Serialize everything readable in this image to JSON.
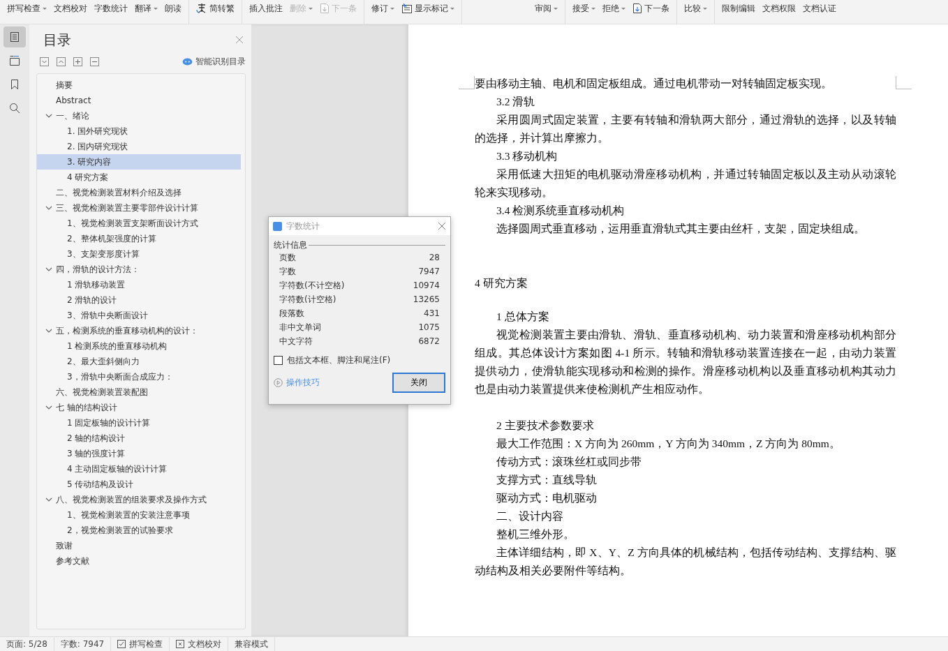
{
  "toolbar": {
    "groups": [
      [
        {
          "kind": "text",
          "label": "拼写检查",
          "caret": true,
          "disabled": false
        },
        {
          "kind": "text",
          "label": "文档校对",
          "caret": false,
          "disabled": false
        },
        {
          "kind": "text",
          "label": "字数统计",
          "caret": false,
          "disabled": false
        },
        {
          "kind": "text",
          "label": "翻译",
          "caret": true,
          "disabled": false
        },
        {
          "kind": "text",
          "label": "朗读",
          "caret": false,
          "disabled": false
        }
      ],
      [
        {
          "kind": "convert",
          "label": "简转繁",
          "caret": false,
          "disabled": false
        }
      ],
      [
        {
          "kind": "text",
          "label": "插入批注",
          "caret": false,
          "disabled": false
        },
        {
          "kind": "text",
          "label": "删除",
          "caret": true,
          "disabled": true
        },
        {
          "kind": "next",
          "label": "下一条",
          "caret": false,
          "disabled": true
        }
      ],
      [
        {
          "kind": "text",
          "label": "修订",
          "caret": true,
          "disabled": false
        },
        {
          "kind": "markup",
          "label": "显示标记",
          "caret": true,
          "disabled": false
        }
      ],
      [
        {
          "kind": "text",
          "label": "审阅",
          "caret": true,
          "disabled": false
        }
      ],
      [
        {
          "kind": "text",
          "label": "接受",
          "caret": true,
          "disabled": false
        },
        {
          "kind": "text",
          "label": "拒绝",
          "caret": true,
          "disabled": false
        },
        {
          "kind": "next",
          "label": "下一条",
          "caret": false,
          "disabled": false
        }
      ],
      [
        {
          "kind": "text",
          "label": "比较",
          "caret": true,
          "disabled": false
        }
      ],
      [
        {
          "kind": "text",
          "label": "限制编辑",
          "caret": false,
          "disabled": false
        },
        {
          "kind": "text",
          "label": "文档权限",
          "caret": false,
          "disabled": false
        },
        {
          "kind": "text",
          "label": "文档认证",
          "caret": false,
          "disabled": false
        }
      ]
    ]
  },
  "rail_tabs": [
    {
      "kind": "toc",
      "selected": true
    },
    {
      "kind": "nav",
      "selected": false
    },
    {
      "kind": "bookmark",
      "selected": false
    },
    {
      "kind": "search",
      "selected": false
    }
  ],
  "toc": {
    "title": "目录",
    "smart_label": "智能识别目录",
    "items": [
      {
        "label": "摘要",
        "selected": false
      },
      {
        "label": "Abstract",
        "selected": false
      },
      {
        "label": "一、绪论",
        "selected": false,
        "expanded": true,
        "children": [
          {
            "label": "1. 国外研究现状",
            "selected": false
          },
          {
            "label": "2. 国内研究现状",
            "selected": false
          },
          {
            "label": "3. 研究内容",
            "selected": true
          },
          {
            "label": "4  研究方案",
            "selected": false
          }
        ]
      },
      {
        "label": "二、视觉检测装置材料介绍及选择",
        "selected": false
      },
      {
        "label": "三、视觉检测装置主要零部件设计计算",
        "selected": false,
        "expanded": true,
        "children": [
          {
            "label": "1、视觉检测装置支架断面设计方式",
            "selected": false
          },
          {
            "label": "2、整体机架强度的计算",
            "selected": false
          },
          {
            "label": "3、支架变形度计算",
            "selected": false
          }
        ]
      },
      {
        "label": "四，滑轨的设计方法：",
        "selected": false,
        "expanded": true,
        "children": [
          {
            "label": "1  滑轨移动装置",
            "selected": false
          },
          {
            "label": "2 滑轨的设计",
            "selected": false
          },
          {
            "label": "3、滑轨中央断面设计",
            "selected": false
          }
        ]
      },
      {
        "label": "五，检测系统的垂直移动机构的设计：",
        "selected": false,
        "expanded": true,
        "children": [
          {
            "label": "1  检测系统的垂直移动机构",
            "selected": false
          },
          {
            "label": "2、最大歪斜侧向力",
            "selected": false
          },
          {
            "label": "3，滑轨中央断面合成应力：",
            "selected": false
          }
        ]
      },
      {
        "label": "六、视觉检测装置装配图",
        "selected": false
      },
      {
        "label": "七  轴的结构设计",
        "selected": false,
        "expanded": true,
        "children": [
          {
            "label": "1    固定板轴的设计计算",
            "selected": false
          },
          {
            "label": "2 轴的结构设计",
            "selected": false
          },
          {
            "label": "3    轴的强度计算",
            "selected": false
          },
          {
            "label": "4  主动固定板轴的设计计算",
            "selected": false
          },
          {
            "label": "5  传动结构及设计",
            "selected": false
          }
        ]
      },
      {
        "label": "八、视觉检测装置的组装要求及操作方式",
        "selected": false,
        "expanded": true,
        "children": [
          {
            "label": "1、视觉检测装置的安装注意事项",
            "selected": false
          },
          {
            "label": "2，视觉检测装置的试验要求",
            "selected": false
          }
        ]
      },
      {
        "label": "致谢",
        "selected": false
      },
      {
        "label": "参考文献",
        "selected": false
      }
    ]
  },
  "document": {
    "paragraphs": [
      {
        "kind": "text",
        "text": "要由移动主轴、电机和固定板组成。通过电机带动一对转轴固定板实现。"
      },
      {
        "kind": "indent",
        "text": "3.2  滑轨"
      },
      {
        "kind": "indent",
        "text": "采用圆周式固定装置，主要有转轴和滑轨两大部分，通过滑轨的选择，以及转轴的选择，并计算出摩擦力。"
      },
      {
        "kind": "indent",
        "text": "3.3  移动机构"
      },
      {
        "kind": "indent",
        "text": "采用低速大扭矩的电机驱动滑座移动机构，并通过转轴固定板以及主动从动滚轮轮来实现移动。"
      },
      {
        "kind": "indent",
        "text": "3.4  检测系统垂直移动机构"
      },
      {
        "kind": "indent",
        "text": "选择圆周式垂直移动，运用垂直滑轨式其主要由丝杆，支架，固定块组成。"
      },
      {
        "kind": "heading",
        "text": "4  研究方案"
      },
      {
        "kind": "subheading",
        "text": "1  总体方案"
      },
      {
        "kind": "indent",
        "text": "视觉检测装置主要由滑轨、滑轨、垂直移动机构、动力装置和滑座移动机构部分组成。其总体设计方案如图 4-1 所示。转轴和滑轨移动装置连接在一起，由动力装置提供动力，使滑轨能实现移动和检测的操作。滑座移动机构以及垂直移动机构其动力也是由动力装置提供来使检测机产生相应动作。"
      },
      {
        "kind": "subheading",
        "text": "2  主要技术参数要求"
      },
      {
        "kind": "indent",
        "text": "最大工作范围：X  方向为  260mm，Y  方向为  340mm，Z  方向为  80mm。"
      },
      {
        "kind": "indent",
        "text": "传动方式：滚珠丝杠或同步带"
      },
      {
        "kind": "indent",
        "text": "支撑方式：直线导轨"
      },
      {
        "kind": "indent",
        "text": "驱动方式：电机驱动"
      },
      {
        "kind": "indent",
        "text": "二、设计内容"
      },
      {
        "kind": "indent",
        "text": "整机三维外形。"
      },
      {
        "kind": "indent",
        "text": "主体详细结构，即  X、Y、Z  方向具体的机械结构，包括传动结构、支撑结构、驱动结构及相关必要附件等结构。"
      }
    ]
  },
  "dialog": {
    "title": "字数统计",
    "section": "统计信息",
    "rows": [
      {
        "label": "页数",
        "value": "28"
      },
      {
        "label": "字数",
        "value": "7947"
      },
      {
        "label": "字符数(不计空格)",
        "value": "10974"
      },
      {
        "label": "字符数(计空格)",
        "value": "13265"
      },
      {
        "label": "段落数",
        "value": "431"
      },
      {
        "label": "非中文单词",
        "value": "1075"
      },
      {
        "label": "中文字符",
        "value": "6872"
      }
    ],
    "checkbox": {
      "label": "包括文本框、脚注和尾注(F)",
      "checked": false
    },
    "tips_link": "操作技巧",
    "close_button": "关闭"
  },
  "status_bar": {
    "page": "页面: 5/28",
    "words": "字数: 7947",
    "items": [
      {
        "kind": "check",
        "label": "拼写检查"
      },
      {
        "kind": "cross",
        "label": "文档校对"
      },
      {
        "kind": "plain",
        "label": "兼容模式"
      }
    ]
  }
}
